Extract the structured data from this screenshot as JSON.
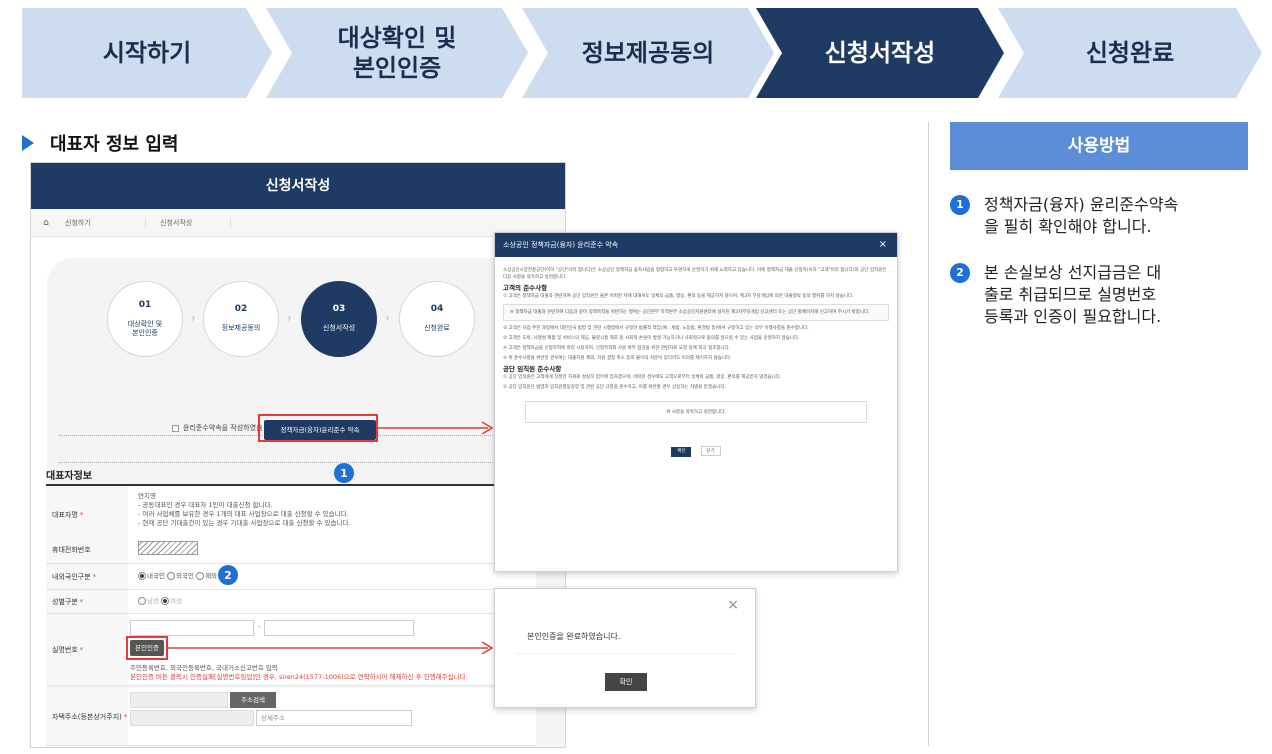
{
  "steps": [
    {
      "label": "시작하기",
      "active": false
    },
    {
      "label": "대상확인 및",
      "label2": "본인인증",
      "active": false
    },
    {
      "label": "정보제공동의",
      "active": false
    },
    {
      "label": "신청서작성",
      "active": true
    },
    {
      "label": "신청완료",
      "active": false
    }
  ],
  "section_title": "대표자 정보 입력",
  "form": {
    "header": "신청서작성",
    "breadcrumb": {
      "home": "⌂",
      "c1": "신청하기",
      "c2": "신청서작성"
    },
    "circles": [
      {
        "n": "01",
        "label": "대상확인 및",
        "label2": "본인인증"
      },
      {
        "n": "02",
        "label": "정보제공동의",
        "label2": ""
      },
      {
        "n": "03",
        "label": "신청서작성",
        "label2": ""
      },
      {
        "n": "04",
        "label": "신청완료",
        "label2": ""
      }
    ],
    "agree_text": "윤리준수약속을 작성하였음",
    "agree_button": "정책자금(융자)윤리준수 약속",
    "rep_title": "대표자정보",
    "rows": {
      "name_label": "대표자명",
      "name_value": "연지영",
      "name_note1": "- 공동대표인 경우 대표자 1인이 대출신청 합니다.",
      "name_note2": "- 여러 사업체를 보유한 경우 1개의 대표 사업장으로 대출 신청할 수 있습니다.",
      "name_note3": "- 현재 공단 기대출건이 있는 경우 기대출 사업장으로 대출 신청할 수 있습니다.",
      "phone_label": "휴대전화번호",
      "nation_label": "내외국인구분",
      "nation_opt1": "내국인",
      "nation_opt2": "외국인",
      "nation_opt3": "해외",
      "gender_label": "성별구분",
      "gender_opt1": "남성",
      "gender_opt2": "여성",
      "id_label": "실명번호",
      "id_dash": "-",
      "auth_button": "본인인증",
      "id_note1": "주민등록번호, 외국인등록번호, 국내거소신고번호 입력",
      "id_note2": "본인인증 버튼 클릭시 인증실패[실명번호임업]인 경우, siren24(1577-1006)으로 연락하시어 해제하신 후 진행해주십니다.",
      "addr_label": "자택주소(등본상거주지)",
      "addr_button": "주소검색",
      "addr_detail": "상세주소"
    },
    "required_mark": "*"
  },
  "modal1": {
    "title": "소상공인 정책자금(융자) 윤리준수 약속",
    "close": "×",
    "intro": "소상공인시장진흥공단(이하 \"공단\"이라 합니다)은 소상공인 정책자금 융자사업을 청렴하고 투명하게 운영하기 위해 노력하고 있습니다. 이에 정책자금 대출 신청자(이하 \"고객\"이라 합니다)와 공단 임직원은 다음 사항을 약속하고 실천합니다.",
    "h1": "고객의 준수사항",
    "p1": "① 고객은 정책자금 대출과 관련하여 공단 임직원은 물론 어떠한 자에 대해서도 일체의 금품, 향응, 편의 등을 제공하지 않으며, 제3자 부당개입에 의한 대출청탁 등의 행위를 하지 않습니다.",
    "box": "※ 정책자금 대출과 관련하여 다음과 같이 정책목적을 위반하는 행위는 공단본부 지역본부 소상공인지원센터에 설치된 제3자부당개입 신고센터 또는 공단 홈페이지에 신고하여 주시기 바랍니다.",
    "p2": "② 고객은 사업 추진 과정에서 대한민국 법령 및 관련 시행령에서 규정한 법률적 책임(예 : 세법, 노동법, 환경법 등)에서 규정하고 있는 의무 이행사항을 준수합니다.",
    "p3": "③ 고객은 도박, 사행성 제품 및 서비스의 제공, 불량식품 제조 등 사회적 손실이 발생 가능하거나 사회적으로 물의를 일으킬 수 있는 사업을 운영하지 않습니다.",
    "p4": "④ 고객은 정책자금을 신청목적에 따라 사용하며, 신청목적외 사용 여부 점검을 위한 관련자료 요청 등에 적극 협조합니다.",
    "p5": "⑤ 위 준수사항을 위반한 경우에는 대출지원 제외, 지원 결정 취소 등의 불이익 처분이 있다라도 이의를 제기하지 않습니다.",
    "h2": "공단 임직원 준수사항",
    "p6": "① 공단 임직원은 고객에게 친절한 자세로 성실히 업무에 임하겠으며, 어떠한 경우에도 고객으로부터 일체의 금품, 향응, 편의를 제공받지 않겠습니다.",
    "p7": "② 공단 임직원은 법령과 임직원행동강령 및 관련 공단 규정을 준수하고, 이를 위반할 경우 상응하는 처벌을 받겠습니다.",
    "agree": "위 사항을 약속하고 실천합니다.",
    "ok": "확인",
    "cancel": "닫기"
  },
  "modal2": {
    "close": "×",
    "message": "본인인증을 완료하였습니다.",
    "ok": "확인"
  },
  "howto": {
    "title": "사용방법",
    "items": [
      {
        "n": "1",
        "text": "정책자금(융자) 윤리준수약속",
        "text2": "을 필히 확인해야 합니다."
      },
      {
        "n": "2",
        "text": "본 손실보상 선지급금은 대",
        "text2": "출로 취급되므로 실명번호",
        "text3": "등록과 인증이 필요합니다."
      }
    ]
  },
  "badges": {
    "one": "1",
    "two": "2"
  },
  "colors": {
    "navy": "#1f3a63",
    "step_bg": "#cddcef",
    "accent_blue": "#1f6fd6",
    "howto_blue": "#5b8ed6",
    "red": "#e53935"
  }
}
